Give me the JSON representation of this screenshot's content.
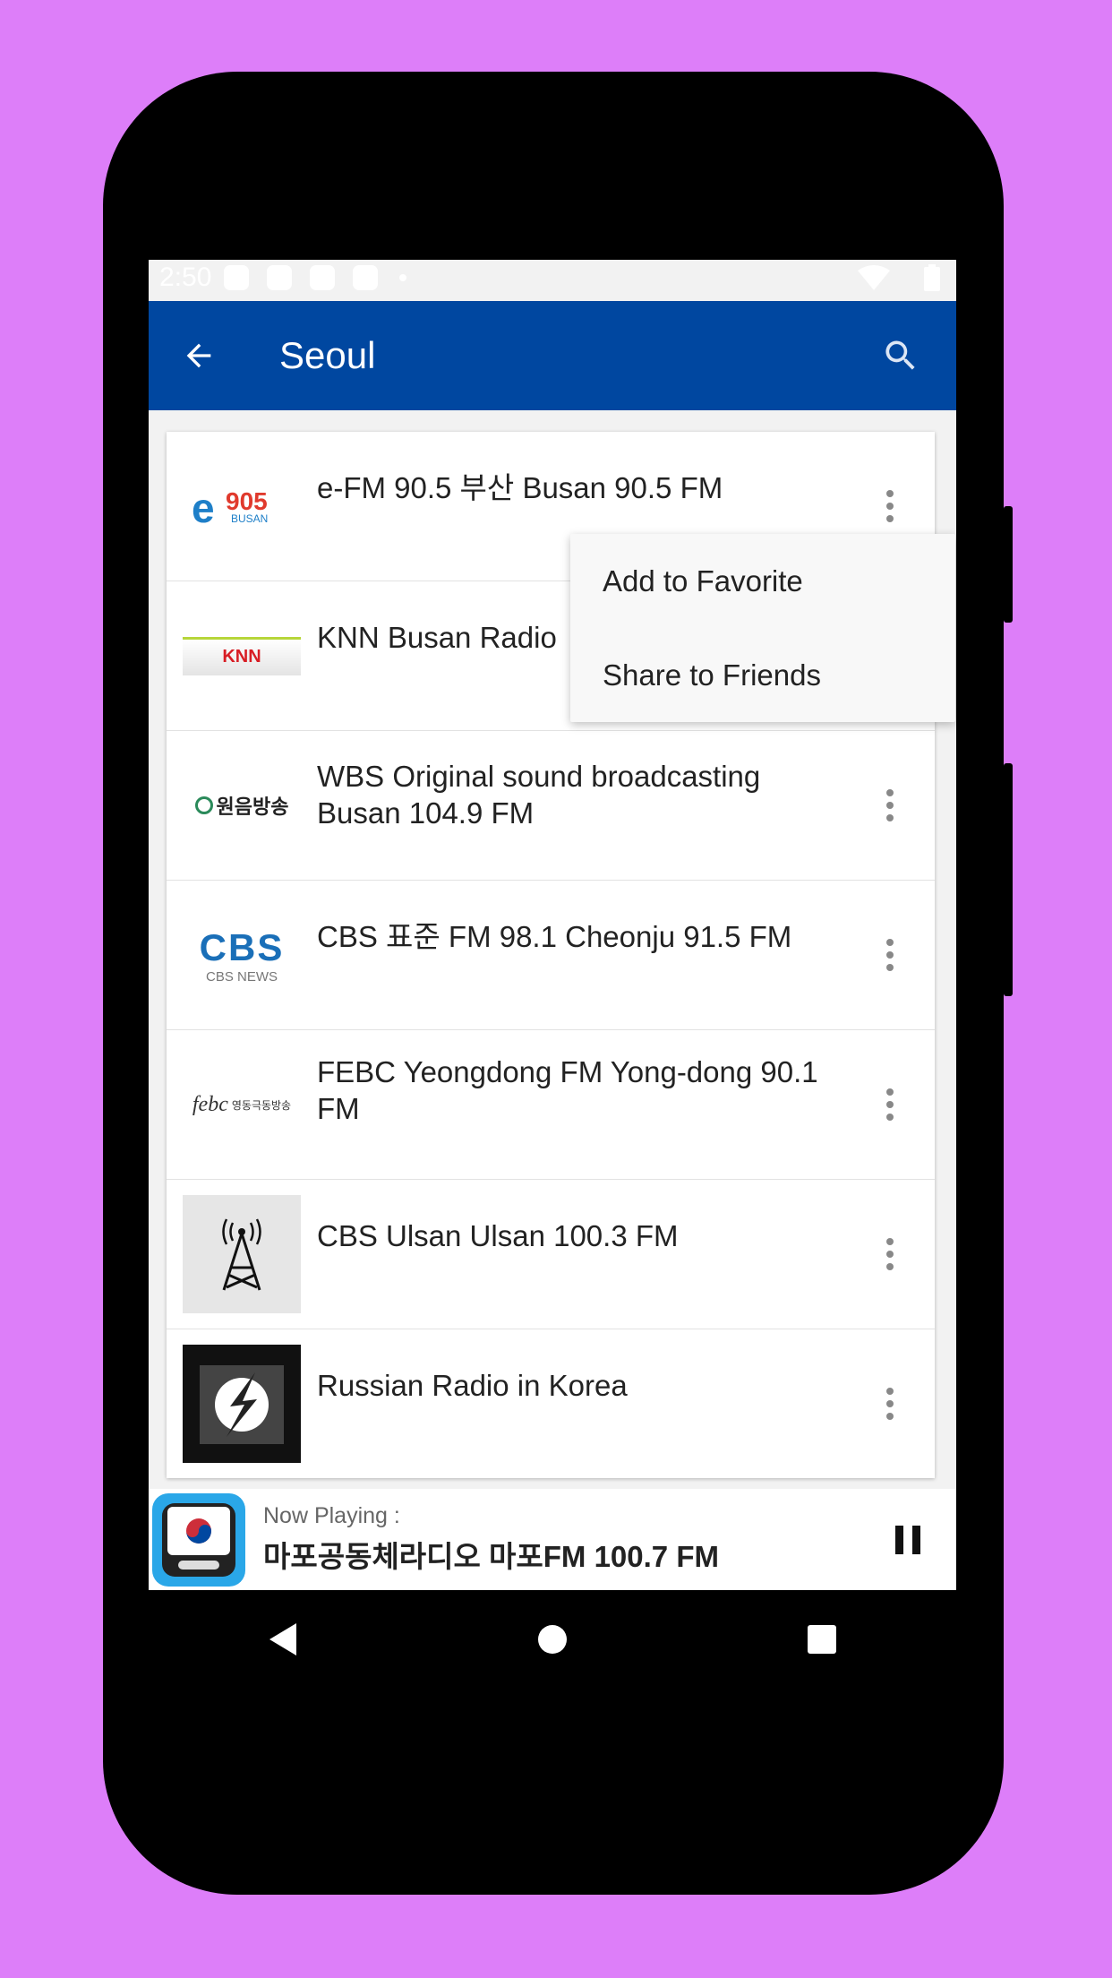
{
  "status_bar": {
    "time": "2:50"
  },
  "app_bar": {
    "title": "Seoul"
  },
  "stations": [
    {
      "name": "e-FM 90.5 부산 Busan 90.5 FM",
      "logo": "efm-905-busan-logo"
    },
    {
      "name": "KNN Busan Radio",
      "logo": "knn-logo"
    },
    {
      "name": "WBS Original sound broadcasting Busan 104.9 FM",
      "logo": "wbs-logo"
    },
    {
      "name": "CBS 표준 FM 98.1 Cheonju 91.5 FM",
      "logo": "cbs-news-logo"
    },
    {
      "name": "FEBC Yeongdong FM Yong-dong 90.1 FM",
      "logo": "febc-logo"
    },
    {
      "name": "CBS Ulsan Ulsan 100.3 FM",
      "logo": "radio-tower-icon"
    },
    {
      "name": "Russian Radio in Korea",
      "logo": "lightning-logo"
    }
  ],
  "logo_texts": {
    "efm": "905",
    "efm_sub": "BUSAN",
    "knn": "KNN",
    "wbs": "원음방송",
    "cbs": "CBS",
    "cbs_sub": "CBS NEWS",
    "febc": "febc",
    "febc_sub": "영동극동방송"
  },
  "context_menu": {
    "items": [
      "Add to Favorite",
      "Share to Friends"
    ]
  },
  "now_playing": {
    "label": "Now Playing :",
    "track": "마포공동체라디오 마포FM 100.7 FM"
  },
  "colors": {
    "background": "#dd7ef9",
    "app_bar": "#0047a0"
  }
}
